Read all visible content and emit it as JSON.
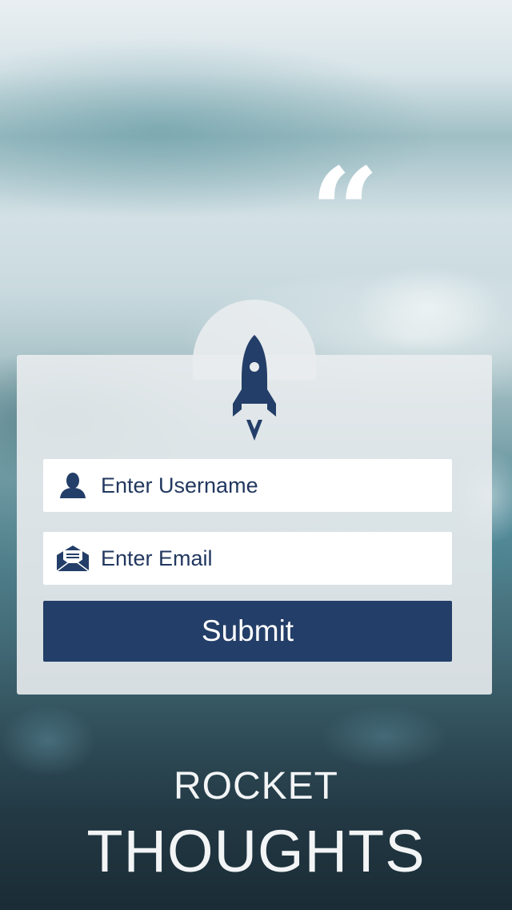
{
  "hero": {
    "quote_glyph": "“"
  },
  "form": {
    "logo_icon": "rocket-icon",
    "username": {
      "icon": "user-icon",
      "placeholder": "Enter Username",
      "value": ""
    },
    "email": {
      "icon": "envelope-icon",
      "placeholder": "Enter Email",
      "value": ""
    },
    "submit_label": "Submit"
  },
  "brand": {
    "line1": "ROCKET",
    "line2": "THOUGHTS"
  },
  "colors": {
    "accent": "#233e68",
    "card": "#e9ecee",
    "text_on_accent": "#ffffff"
  }
}
